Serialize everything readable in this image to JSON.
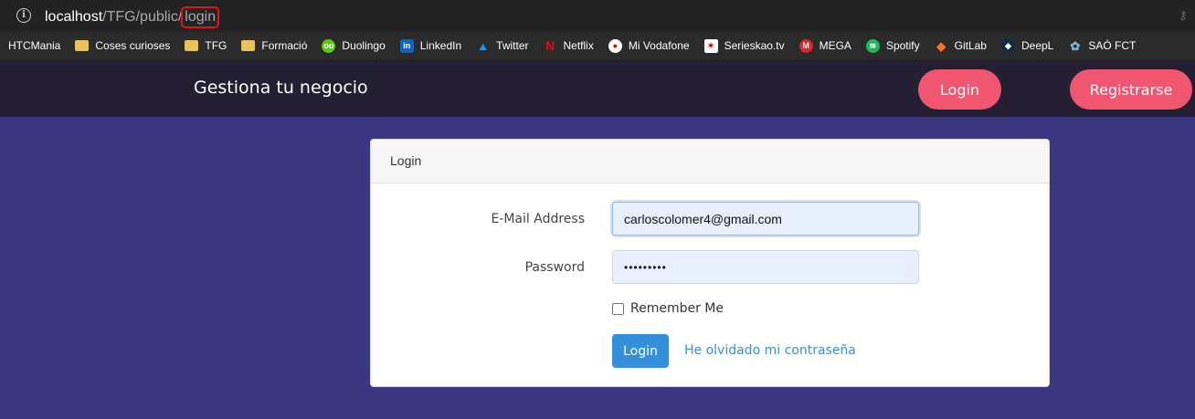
{
  "browser": {
    "url_host": "localhost",
    "url_path": "/TFG/public/",
    "url_highlight": "login"
  },
  "bookmarks": [
    {
      "label": "HTCMania",
      "icon": "none"
    },
    {
      "label": "Coses curioses",
      "icon": "folder-icon"
    },
    {
      "label": "TFG",
      "icon": "folder-icon"
    },
    {
      "label": "Formació",
      "icon": "folder-icon"
    },
    {
      "label": "Duolingo",
      "icon": "duolingo-icon"
    },
    {
      "label": "LinkedIn",
      "icon": "linkedin-icon"
    },
    {
      "label": "Twitter",
      "icon": "twitter-icon"
    },
    {
      "label": "Netflix",
      "icon": "netflix-icon"
    },
    {
      "label": "Mi Vodafone",
      "icon": "vodafone-icon"
    },
    {
      "label": "Serieskao.tv",
      "icon": "serieskao-icon"
    },
    {
      "label": "MEGA",
      "icon": "mega-icon"
    },
    {
      "label": "Spotify",
      "icon": "spotify-icon"
    },
    {
      "label": "GitLab",
      "icon": "gitlab-icon"
    },
    {
      "label": "DeepL",
      "icon": "deepl-icon"
    },
    {
      "label": "SAÓ FCT",
      "icon": "sao-icon"
    }
  ],
  "navbar": {
    "brand": "Gestiona tu negocio",
    "login_label": "Login",
    "register_label": "Registrarse"
  },
  "login_card": {
    "header": "Login",
    "email_label": "E-Mail Address",
    "email_value": "carloscolomer4@gmail.com",
    "password_label": "Password",
    "password_value": "•••••••••",
    "remember_label": "Remember Me",
    "submit_label": "Login",
    "forgot_label": "He olvidado mi contraseña"
  },
  "colors": {
    "page_bg": "#3b3780",
    "navbar_bg": "#241f33",
    "accent_pink": "#f0566f",
    "primary_blue": "#3490dc"
  }
}
